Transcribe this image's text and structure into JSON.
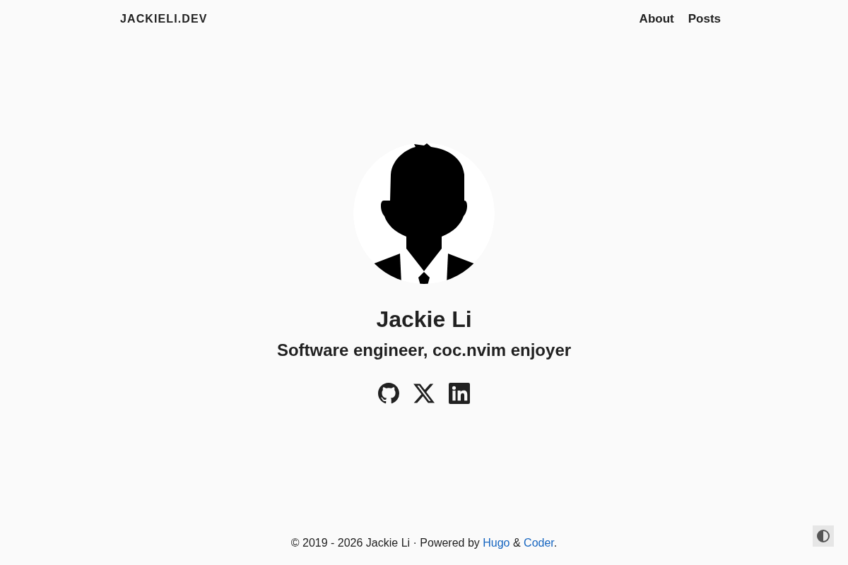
{
  "header": {
    "brand": "JACKIELI.DEV",
    "nav": [
      "About",
      "Posts"
    ]
  },
  "profile": {
    "name": "Jackie Li",
    "tagline": "Software engineer, coc.nvim enjoyer",
    "social_links": [
      {
        "kind": "github"
      },
      {
        "kind": "x"
      },
      {
        "kind": "linkedin"
      }
    ]
  },
  "footer": {
    "parts": [
      {
        "kind": "text",
        "text": "© 2019 - 2026 Jackie Li · Powered by "
      },
      {
        "kind": "link",
        "text": "Hugo"
      },
      {
        "kind": "text",
        "text": " & "
      },
      {
        "kind": "link",
        "text": "Coder"
      },
      {
        "kind": "text",
        "text": "."
      }
    ]
  }
}
